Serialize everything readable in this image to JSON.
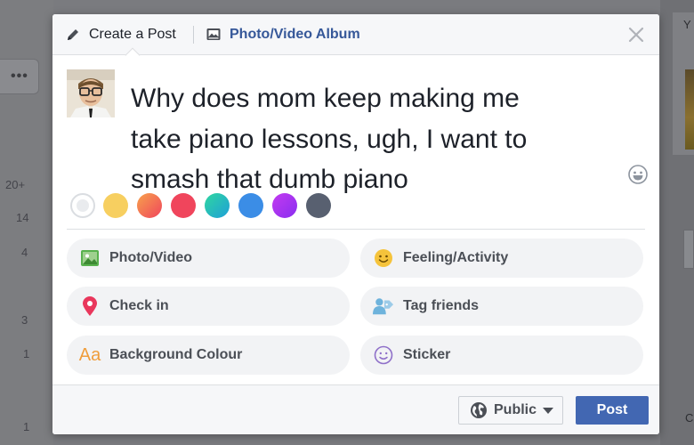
{
  "background": {
    "more_button": "•••",
    "counts": [
      "20+",
      "14",
      "4",
      "3",
      "1",
      "1"
    ],
    "right_letters": [
      "Y",
      "C"
    ]
  },
  "header": {
    "create_tab": "Create a Post",
    "album_tab": "Photo/Video Album"
  },
  "composer": {
    "post_text_lines": [
      "Why does mom keep making me",
      "take piano lessons, ugh, I want to",
      "smash that dumb piano"
    ]
  },
  "background_colors": [
    "#e9ebee",
    "#f7cf60",
    "#f5665a",
    "#f0455c",
    "#20c4a6",
    "#3b8de6",
    "#a62ef0",
    "#586070"
  ],
  "options": [
    {
      "label": "Photo/Video",
      "icon": "photo-icon",
      "color": "#58b14d"
    },
    {
      "label": "Feeling/Activity",
      "icon": "smiley-icon",
      "color": "#f5c33b"
    },
    {
      "label": "Check in",
      "icon": "location-pin-icon",
      "color": "#e9375c"
    },
    {
      "label": "Tag friends",
      "icon": "tag-friends-icon",
      "color": "#6eb3dc"
    },
    {
      "label": "Background Colour",
      "icon": "text-aa-icon",
      "color": "#f09d3b"
    },
    {
      "label": "Sticker",
      "icon": "sticker-icon",
      "color": "#8f70c9"
    }
  ],
  "footer": {
    "audience_label": "Public",
    "post_label": "Post"
  },
  "colors": {
    "link_blue": "#365899",
    "primary_button": "#4267b2"
  }
}
